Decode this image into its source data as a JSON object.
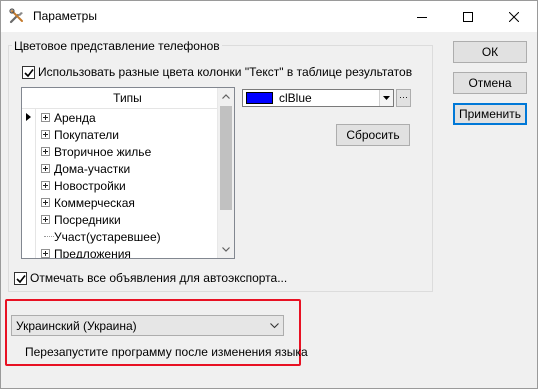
{
  "window": {
    "title": "Параметры"
  },
  "group": {
    "title": "Цветовое представление телефонов"
  },
  "use_colors_checkbox": {
    "label": "Использовать разные цвета колонки \"Текст\" в таблице результатов",
    "checked": true
  },
  "types_tree": {
    "header": "Типы",
    "rows": [
      {
        "label": "Аренда",
        "expandable": true,
        "current": true
      },
      {
        "label": "Покупатели",
        "expandable": true
      },
      {
        "label": "Вторичное жилье",
        "expandable": true
      },
      {
        "label": "Дома-участки",
        "expandable": true
      },
      {
        "label": "Новостройки",
        "expandable": true
      },
      {
        "label": "Коммерческая",
        "expandable": true
      },
      {
        "label": "Посредники",
        "expandable": true
      },
      {
        "label": "Участ(устаревшее)",
        "expandable": false
      },
      {
        "label": "Предложения",
        "expandable": true
      }
    ]
  },
  "color_picker": {
    "value": "clBlue",
    "swatch_color": "#0000ff",
    "ellipsis_label": "···"
  },
  "reset_button": {
    "label": "Сбросить"
  },
  "autoexport_checkbox": {
    "label": "Отмечать все объявления для автоэкспорта...",
    "checked": true
  },
  "language": {
    "selected": "Украинский (Украина)",
    "note": "Перезапустите программу после изменения языка",
    "highlight_color": "#e81123"
  },
  "dialog_buttons": {
    "ok": "ОК",
    "cancel": "Отмена",
    "apply": "Применить"
  },
  "icons": {
    "title_icon": "tools-icon",
    "minimize": "minimize-icon",
    "maximize": "maximize-icon",
    "close": "close-icon"
  }
}
